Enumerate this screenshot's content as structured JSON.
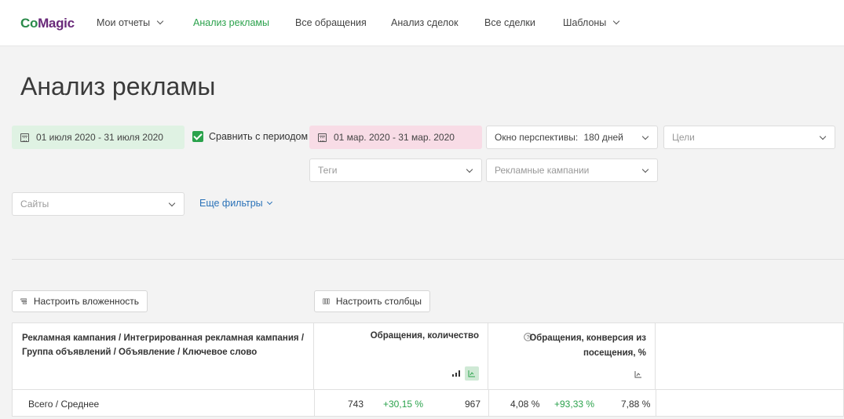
{
  "logo": {
    "part1": "Co",
    "part2": "Magic"
  },
  "nav": {
    "my_reports": "Мои отчеты",
    "ad_analysis": "Анализ рекламы",
    "all_requests": "Все обращения",
    "deal_analysis": "Анализ сделок",
    "all_deals": "Все сделки",
    "templates": "Шаблоны"
  },
  "page": {
    "title": "Анализ рекламы"
  },
  "filters": {
    "period": "01 июля 2020 - 31 июля 2020",
    "compare_label": "Сравнить с периодом",
    "compare_period": "01 мар. 2020 - 31 мар. 2020",
    "window_label": "Окно перспективы:",
    "window_value": "180 дней",
    "goals_placeholder": "Цели",
    "tags_placeholder": "Теги",
    "campaigns_placeholder": "Рекламные кампании",
    "sites_placeholder": "Сайты",
    "more_filters": "Еще фильтры"
  },
  "toolbar": {
    "nesting_button": "Настроить вложенность",
    "columns_button": "Настроить столбцы"
  },
  "table": {
    "col1_header": "Рекламная кампания / Интегрированная рекламная кампания / Группа объявлений / Объявление / Ключевое слово",
    "col2_header": "Обращения, количество",
    "col3_header": "Обращения, конверсия из посещения, %",
    "row_total": {
      "label": "Всего / Среднее",
      "requests_value": "743",
      "requests_change": "+30,15 %",
      "requests_compare": "967",
      "conv_value": "4,08 %",
      "conv_change": "+93,33 %",
      "conv_compare": "7,88 %"
    }
  },
  "icons": {
    "calendar": "calendar-icon",
    "checkbox": "check-icon",
    "nesting": "nesting-icon",
    "columns": "columns-icon",
    "help": "help-circle-icon",
    "bar_chart": "bar-chart-icon",
    "line_chart": "line-chart-icon"
  },
  "colors": {
    "accent_green": "#2ba24c",
    "link_blue": "#2a72b8",
    "period_bg": "#dff2e3",
    "compare_bg": "#f8dce6"
  }
}
